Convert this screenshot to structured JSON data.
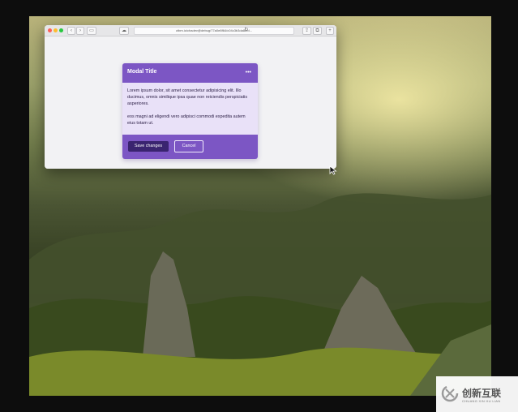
{
  "browser": {
    "url": "ctbm.io/chadev@debug/77a0e8f64/c04c3b3da8b/d..."
  },
  "modal": {
    "title": "Modal Title",
    "more_icon": "more-horizontal-icon",
    "body_paragraphs": [
      "Lorem ipsum dolor, sit amet consectetur adipisicing elit. Illo ducimus, omnis similique ipsa quae non reiciendis perspiciatis asperiores.",
      "eos magni ad eligendi vero adipisci commodi expedita autem eius totam ut."
    ],
    "save_label": "Save changes",
    "cancel_label": "Cancel"
  },
  "colors": {
    "modal_header": "#7c56c4",
    "modal_body": "#e9e1f8",
    "primary_button": "#3a2470"
  },
  "watermark": {
    "logo": "swirl-logo",
    "brand": "创新互联",
    "sub": "CHUANG XIN HU LIAN"
  }
}
